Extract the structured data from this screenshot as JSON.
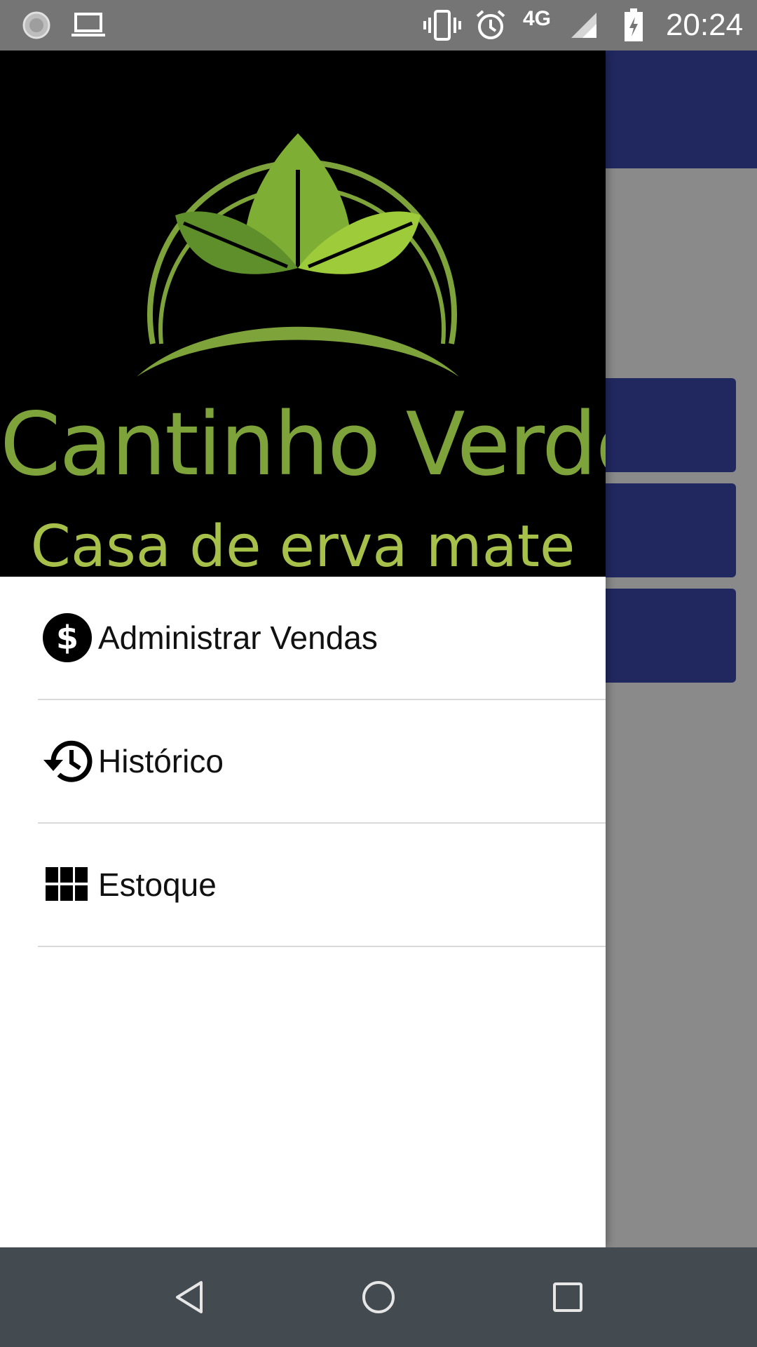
{
  "status_bar": {
    "network": "4G",
    "time": "20:24",
    "icons": [
      "loading-icon",
      "laptop-icon",
      "vibrate-icon",
      "alarm-icon",
      "signal-icon",
      "battery-charging-icon"
    ]
  },
  "drawer": {
    "brand": {
      "name": "Cantinho Verde",
      "tagline": "Casa de erva mate"
    },
    "items": [
      {
        "label": "Administrar Vendas",
        "icon": "dollar-icon"
      },
      {
        "label": "Histórico",
        "icon": "history-icon"
      },
      {
        "label": "Estoque",
        "icon": "grid-icon"
      }
    ]
  },
  "nav_bar": {
    "buttons": [
      "back-icon",
      "home-icon",
      "recents-icon"
    ]
  },
  "colors": {
    "toolbar": "#212860",
    "brand_green": "#7ea33a",
    "status_bar": "#757575",
    "nav_bar": "#434b51"
  }
}
